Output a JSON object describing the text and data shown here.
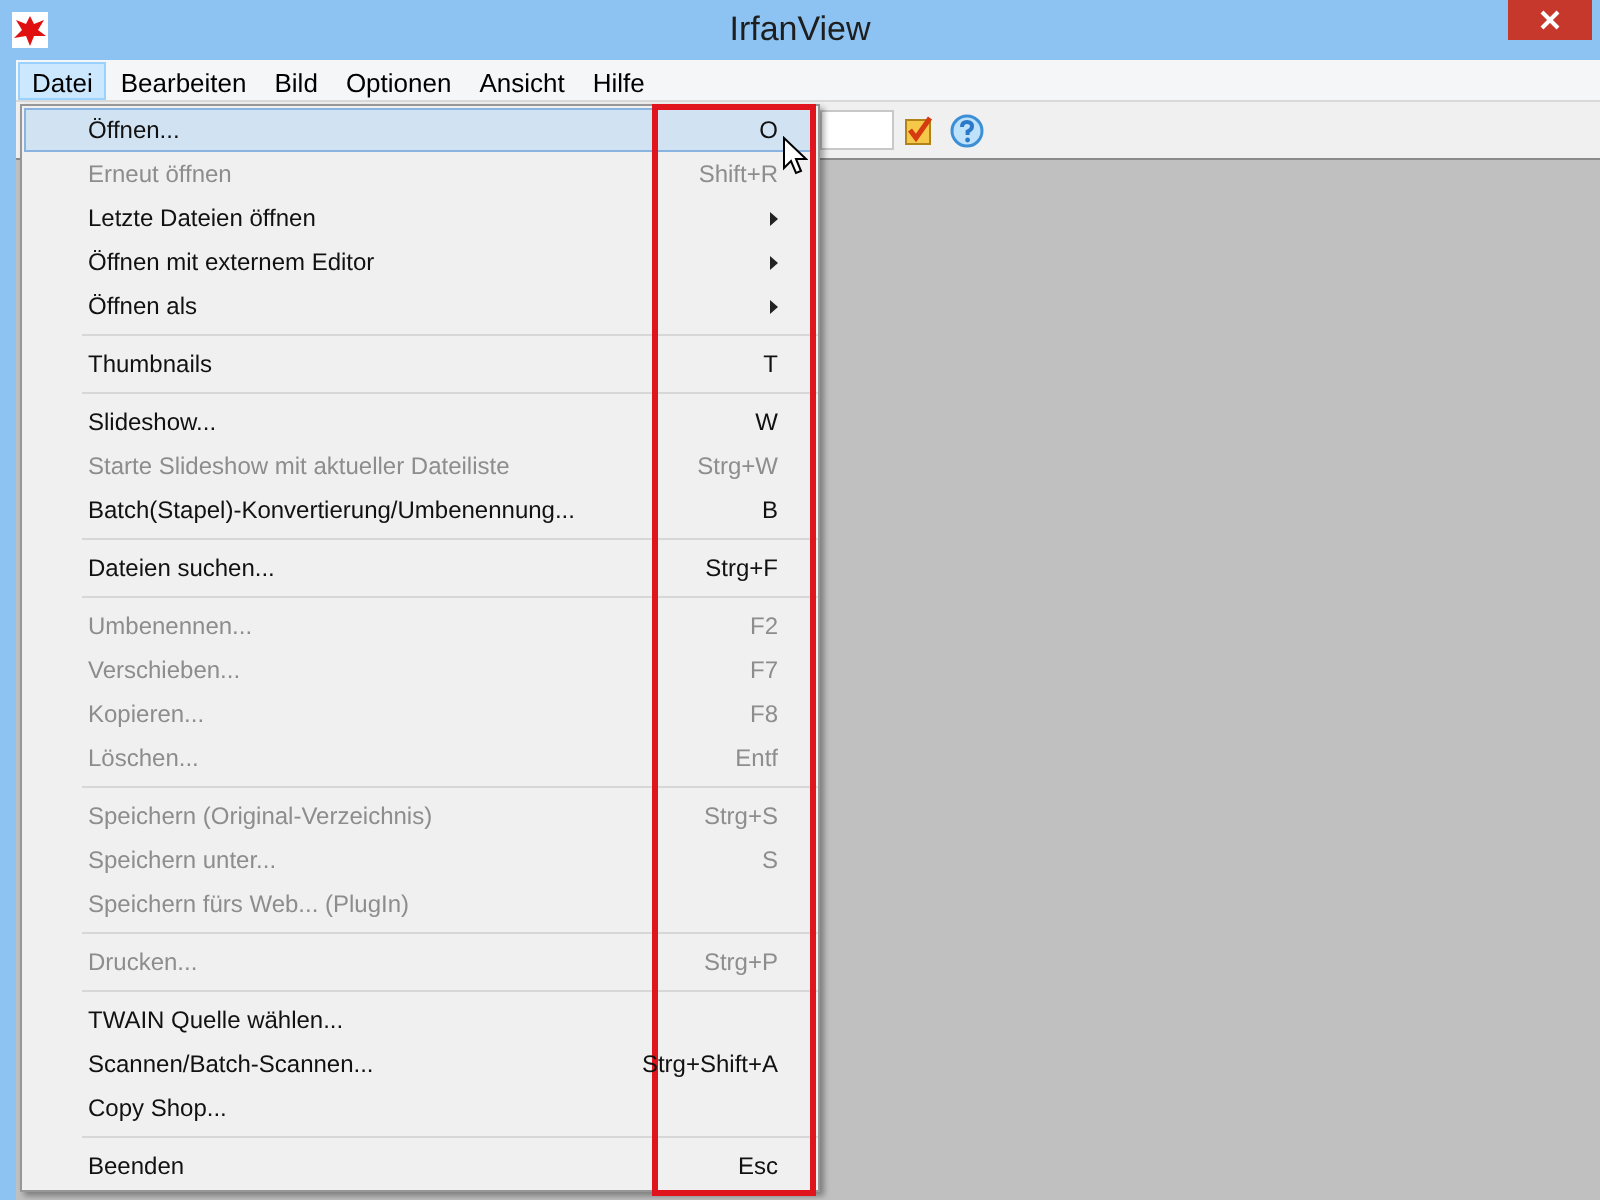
{
  "window": {
    "title": "IrfanView"
  },
  "menu_bar": [
    {
      "label": "Datei",
      "selected": true
    },
    {
      "label": "Bearbeiten",
      "selected": false
    },
    {
      "label": "Bild",
      "selected": false
    },
    {
      "label": "Optionen",
      "selected": false
    },
    {
      "label": "Ansicht",
      "selected": false
    },
    {
      "label": "Hilfe",
      "selected": false
    }
  ],
  "file_menu": [
    [
      {
        "label": "Öffnen...",
        "shortcut": "O",
        "disabled": false,
        "selected": true,
        "submenu": false
      },
      {
        "label": "Erneut öffnen",
        "shortcut": "Shift+R",
        "disabled": true,
        "selected": false,
        "submenu": false
      },
      {
        "label": "Letzte Dateien öffnen",
        "disabled": false,
        "selected": false,
        "submenu": true
      },
      {
        "label": "Öffnen mit externem Editor",
        "disabled": false,
        "selected": false,
        "submenu": true
      },
      {
        "label": "Öffnen als",
        "disabled": false,
        "selected": false,
        "submenu": true
      }
    ],
    [
      {
        "label": "Thumbnails",
        "shortcut": "T",
        "disabled": false,
        "selected": false,
        "submenu": false
      }
    ],
    [
      {
        "label": "Slideshow...",
        "shortcut": "W",
        "disabled": false,
        "selected": false,
        "submenu": false
      },
      {
        "label": "Starte Slideshow mit aktueller Dateiliste",
        "shortcut": "Strg+W",
        "disabled": true,
        "selected": false,
        "submenu": false
      },
      {
        "label": "Batch(Stapel)-Konvertierung/Umbenennung...",
        "shortcut": "B",
        "disabled": false,
        "selected": false,
        "submenu": false
      }
    ],
    [
      {
        "label": "Dateien suchen...",
        "shortcut": "Strg+F",
        "disabled": false,
        "selected": false,
        "submenu": false
      }
    ],
    [
      {
        "label": "Umbenennen...",
        "shortcut": "F2",
        "disabled": true,
        "selected": false,
        "submenu": false
      },
      {
        "label": "Verschieben...",
        "shortcut": "F7",
        "disabled": true,
        "selected": false,
        "submenu": false
      },
      {
        "label": "Kopieren...",
        "shortcut": "F8",
        "disabled": true,
        "selected": false,
        "submenu": false
      },
      {
        "label": "Löschen...",
        "shortcut": "Entf",
        "disabled": true,
        "selected": false,
        "submenu": false
      }
    ],
    [
      {
        "label": "Speichern (Original-Verzeichnis)",
        "shortcut": "Strg+S",
        "disabled": true,
        "selected": false,
        "submenu": false
      },
      {
        "label": "Speichern unter...",
        "shortcut": "S",
        "disabled": true,
        "selected": false,
        "submenu": false
      },
      {
        "label": "Speichern fürs Web... (PlugIn)",
        "disabled": true,
        "selected": false,
        "submenu": false
      }
    ],
    [
      {
        "label": "Drucken...",
        "shortcut": "Strg+P",
        "disabled": true,
        "selected": false,
        "submenu": false
      }
    ],
    [
      {
        "label": "TWAIN Quelle wählen...",
        "disabled": false,
        "selected": false,
        "submenu": false
      },
      {
        "label": "Scannen/Batch-Scannen...",
        "shortcut": "Strg+Shift+A",
        "disabled": false,
        "selected": false,
        "submenu": false
      },
      {
        "label": "Copy Shop...",
        "disabled": false,
        "selected": false,
        "submenu": false
      }
    ],
    [
      {
        "label": "Beenden",
        "shortcut": "Esc",
        "disabled": false,
        "selected": false,
        "submenu": false
      }
    ]
  ]
}
